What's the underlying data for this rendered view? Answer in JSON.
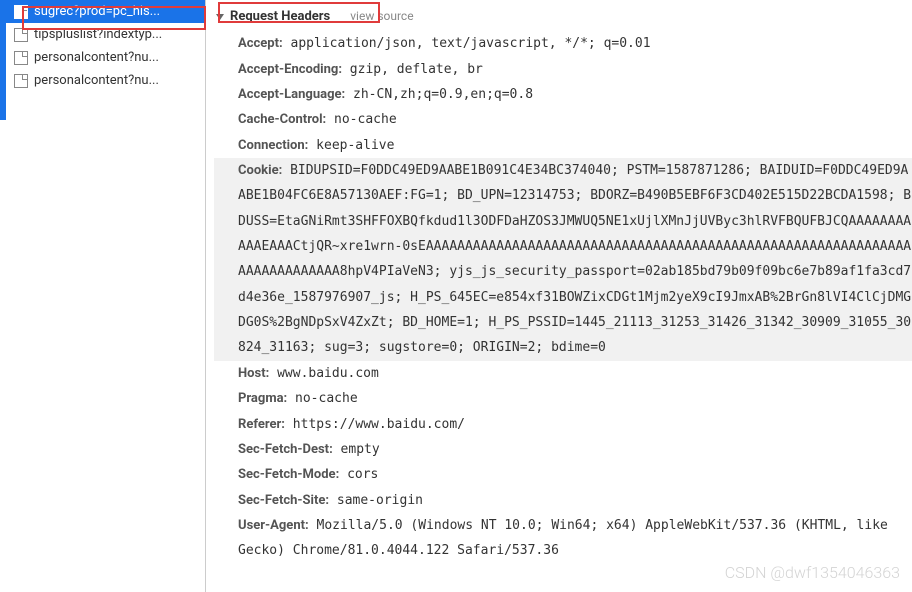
{
  "sidebar": {
    "items": [
      {
        "label": "sugrec?prod=pc_his...",
        "selected": true
      },
      {
        "label": "tipspluslist?indextyp...",
        "selected": false
      },
      {
        "label": "personalcontent?nu...",
        "selected": false
      },
      {
        "label": "personalcontent?nu...",
        "selected": false
      }
    ]
  },
  "section": {
    "title": "Request Headers",
    "viewSource": "view source"
  },
  "headers": {
    "accept": {
      "k": "Accept:",
      "v": " application/json, text/javascript, */*; q=0.01"
    },
    "acceptEncoding": {
      "k": "Accept-Encoding:",
      "v": " gzip, deflate, br"
    },
    "acceptLanguage": {
      "k": "Accept-Language:",
      "v": " zh-CN,zh;q=0.9,en;q=0.8"
    },
    "cacheControl": {
      "k": "Cache-Control:",
      "v": " no-cache"
    },
    "connection": {
      "k": "Connection:",
      "v": " keep-alive"
    },
    "cookie": {
      "k": "Cookie:",
      "v": " BIDUPSID=F0DDC49ED9AABE1B091C4E34BC374040; PSTM=1587871286; BAIDUID=F0DDC49ED9AABE1B04FC6E8A57130AEF:FG=1; BD_UPN=12314753; BDORZ=B490B5EBF6F3CD402E515D22BCDA1598; BDUSS=EtaGNiRmt3SHFFOXBQfkdud1l3ODFDaHZOS3JMWUQ5NE1xUjlXMnJjUVByc3hlRVFBQUFBJCQAAAAAAAAAAAEAAACtjQR~xre1wrn-0sEAAAAAAAAAAAAAAAAAAAAAAAAAAAAAAAAAAAAAAAAAAAAAAAAAAAAAAAAAAAAAAAAAAAAAAAAAAA8hpV4PIaVeN3; yjs_js_security_passport=02ab185bd79b09f09bc6e7b89af1fa3cd7d4e36e_1587976907_js; H_PS_645EC=e854xf31BOWZixCDGt1Mjm2yeX9cI9JmxAB%2BrGn8lVI4ClCjDMGDG0S%2BgNDpSxV4ZxZt; BD_HOME=1; H_PS_PSSID=1445_21113_31253_31426_31342_30909_31055_30824_31163; sug=3; sugstore=0; ORIGIN=2; bdime=0"
    },
    "host": {
      "k": "Host:",
      "v": " www.baidu.com"
    },
    "pragma": {
      "k": "Pragma:",
      "v": " no-cache"
    },
    "referer": {
      "k": "Referer:",
      "v": " https://www.baidu.com/"
    },
    "secFetchDest": {
      "k": "Sec-Fetch-Dest:",
      "v": " empty"
    },
    "secFetchMode": {
      "k": "Sec-Fetch-Mode:",
      "v": " cors"
    },
    "secFetchSite": {
      "k": "Sec-Fetch-Site:",
      "v": " same-origin"
    },
    "userAgent": {
      "k": "User-Agent:",
      "v": " Mozilla/5.0 (Windows NT 10.0; Win64; x64) AppleWebKit/537.36 (KHTML, like Gecko) Chrome/81.0.4044.122 Safari/537.36"
    }
  },
  "watermark": "CSDN @dwf1354046363"
}
